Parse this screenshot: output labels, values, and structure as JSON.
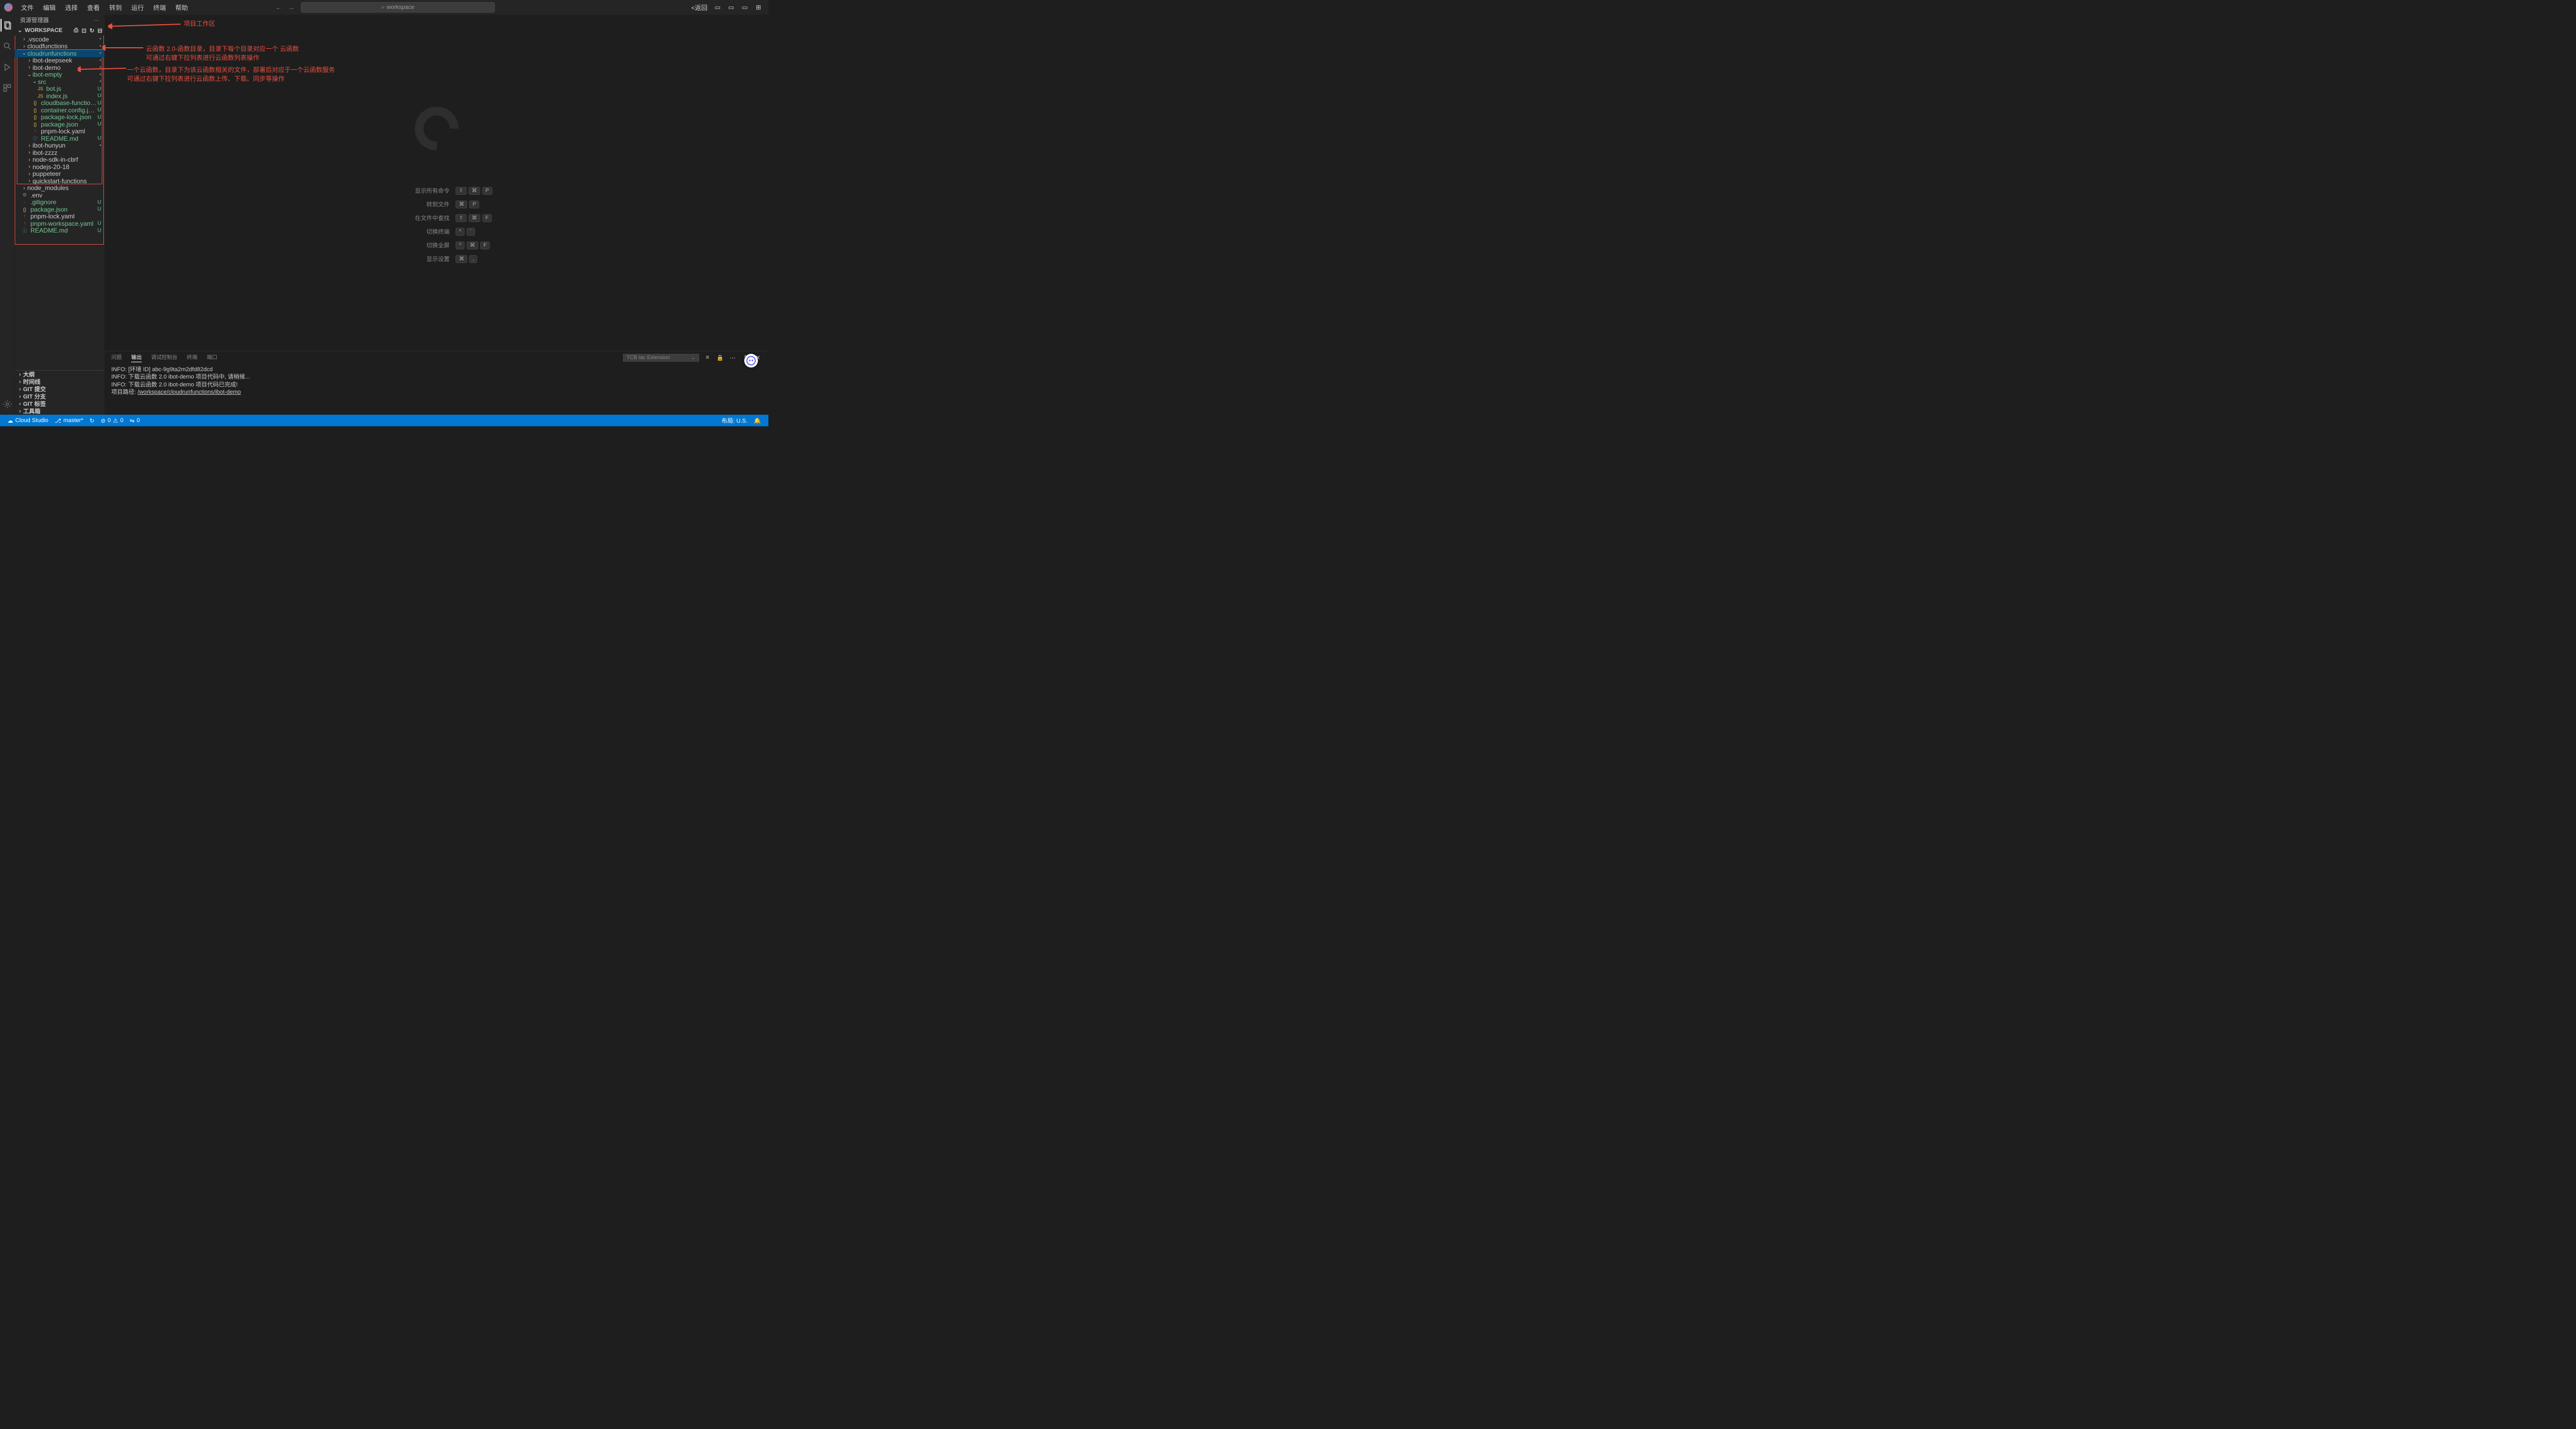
{
  "menu": [
    "文件",
    "编辑",
    "选择",
    "查看",
    "转到",
    "运行",
    "终端",
    "帮助"
  ],
  "search_placeholder": "workspace",
  "back_label": "<返回",
  "sidebar_title": "资源管理器",
  "workspace_label": "WORKSPACE",
  "tree": [
    {
      "d": 1,
      "t": "f",
      "c": ">",
      "n": ".vscode",
      "s": "•"
    },
    {
      "d": 1,
      "t": "f",
      "c": ">",
      "n": "cloudfunctions",
      "s": "•"
    },
    {
      "d": 1,
      "t": "f",
      "c": "v",
      "n": "cloudrunfunctions",
      "s": "•",
      "sel": true,
      "g": true
    },
    {
      "d": 2,
      "t": "f",
      "c": ">",
      "n": "ibot-deepseek",
      "s": "•"
    },
    {
      "d": 2,
      "t": "f",
      "c": ">",
      "n": "ibot-demo",
      "s": "•"
    },
    {
      "d": 2,
      "t": "f",
      "c": "v",
      "n": "ibot-empty",
      "s": "•",
      "g": true
    },
    {
      "d": 3,
      "t": "f",
      "c": "v",
      "n": "src",
      "s": "•",
      "g": true
    },
    {
      "d": 4,
      "t": "js",
      "n": "bot.js",
      "s": "U",
      "g": true
    },
    {
      "d": 4,
      "t": "js",
      "n": "index.js",
      "s": "U",
      "g": true
    },
    {
      "d": 3,
      "t": "json",
      "n": "cloudbase-functions.json",
      "s": "U",
      "g": true
    },
    {
      "d": 3,
      "t": "json",
      "n": "container.config.json",
      "s": "U",
      "g": true
    },
    {
      "d": 3,
      "t": "json",
      "n": "package-lock.json",
      "s": "U",
      "g": true
    },
    {
      "d": 3,
      "t": "json",
      "n": "package.json",
      "s": "U",
      "g": true
    },
    {
      "d": 3,
      "t": "yaml",
      "n": "pnpm-lock.yaml",
      "s": "",
      "g": false
    },
    {
      "d": 3,
      "t": "md",
      "n": "README.md",
      "s": "U",
      "g": true
    },
    {
      "d": 2,
      "t": "f",
      "c": ">",
      "n": "ibot-hunyun",
      "s": "•"
    },
    {
      "d": 2,
      "t": "f",
      "c": ">",
      "n": "ibot-zzzz"
    },
    {
      "d": 2,
      "t": "f",
      "c": ">",
      "n": "node-sdk-in-cbrf"
    },
    {
      "d": 2,
      "t": "f",
      "c": ">",
      "n": "nodejs-20-18"
    },
    {
      "d": 2,
      "t": "f",
      "c": ">",
      "n": "puppeteer"
    },
    {
      "d": 2,
      "t": "f",
      "c": ">",
      "n": "quickstart-functions"
    },
    {
      "d": 1,
      "t": "f",
      "c": ">",
      "n": "node_modules"
    },
    {
      "d": 1,
      "t": "gear",
      "n": ".env"
    },
    {
      "d": 1,
      "t": "file",
      "n": ".gitignore",
      "s": "U",
      "g": true
    },
    {
      "d": 1,
      "t": "json",
      "n": "package.json",
      "s": "U",
      "g": true
    },
    {
      "d": 1,
      "t": "yaml",
      "n": "pnpm-lock.yaml"
    },
    {
      "d": 1,
      "t": "yaml",
      "n": "pnpm-workspace.yaml",
      "s": "U",
      "g": true
    },
    {
      "d": 1,
      "t": "info",
      "n": "README.md",
      "s": "U",
      "g": true
    }
  ],
  "sections": [
    "大纲",
    "时间线",
    "GIT 提交",
    "GIT 分支",
    "GIT 标签",
    "工具箱"
  ],
  "shortcuts": [
    {
      "label": "显示所有命令",
      "keys": [
        "⇧",
        "⌘",
        "P"
      ]
    },
    {
      "label": "转到文件",
      "keys": [
        "⌘",
        "P"
      ]
    },
    {
      "label": "在文件中查找",
      "keys": [
        "⇧",
        "⌘",
        "F"
      ]
    },
    {
      "label": "切换终端",
      "keys": [
        "^",
        "`"
      ]
    },
    {
      "label": "切换全屏",
      "keys": [
        "^",
        "⌘",
        "F"
      ]
    },
    {
      "label": "显示设置",
      "keys": [
        "⌘",
        ","
      ]
    }
  ],
  "panel_tabs": [
    "问题",
    "输出",
    "调试控制台",
    "终端",
    "端口"
  ],
  "panel_dropdown": "TCB Iac Extension",
  "terminal_lines": [
    "INFO: [环境 ID] abc-9g9ta2m2dfd82dcd",
    "INFO: 下载云函数 2.0 ibot-demo 项目代码中, 请稍候...",
    "INFO: 下载云函数 2.0 ibot-demo 项目代码已完成!",
    "项目路径: "
  ],
  "terminal_link": "/workspace/cloudrunfunctions/ibot-demo",
  "status": {
    "cloud": "Cloud Studio",
    "branch": "master*",
    "sync": "↻",
    "errors": "0",
    "warnings": "0",
    "ports": "0",
    "layout": "布局: U.S."
  },
  "annotations": {
    "a1": "项目工作区",
    "a2_l1": "云函数 2.0-函数目录，目录下每个目录对应一个 云函数",
    "a2_l2": "可通过右键下拉列表进行云函数列表操作",
    "a3_l1": "一个云函数，目录下为该云函数相关的文件，部署后对应于一个云函数服务",
    "a3_l2": "可通过右键下拉列表进行云函数上传、下载、同步等操作"
  }
}
